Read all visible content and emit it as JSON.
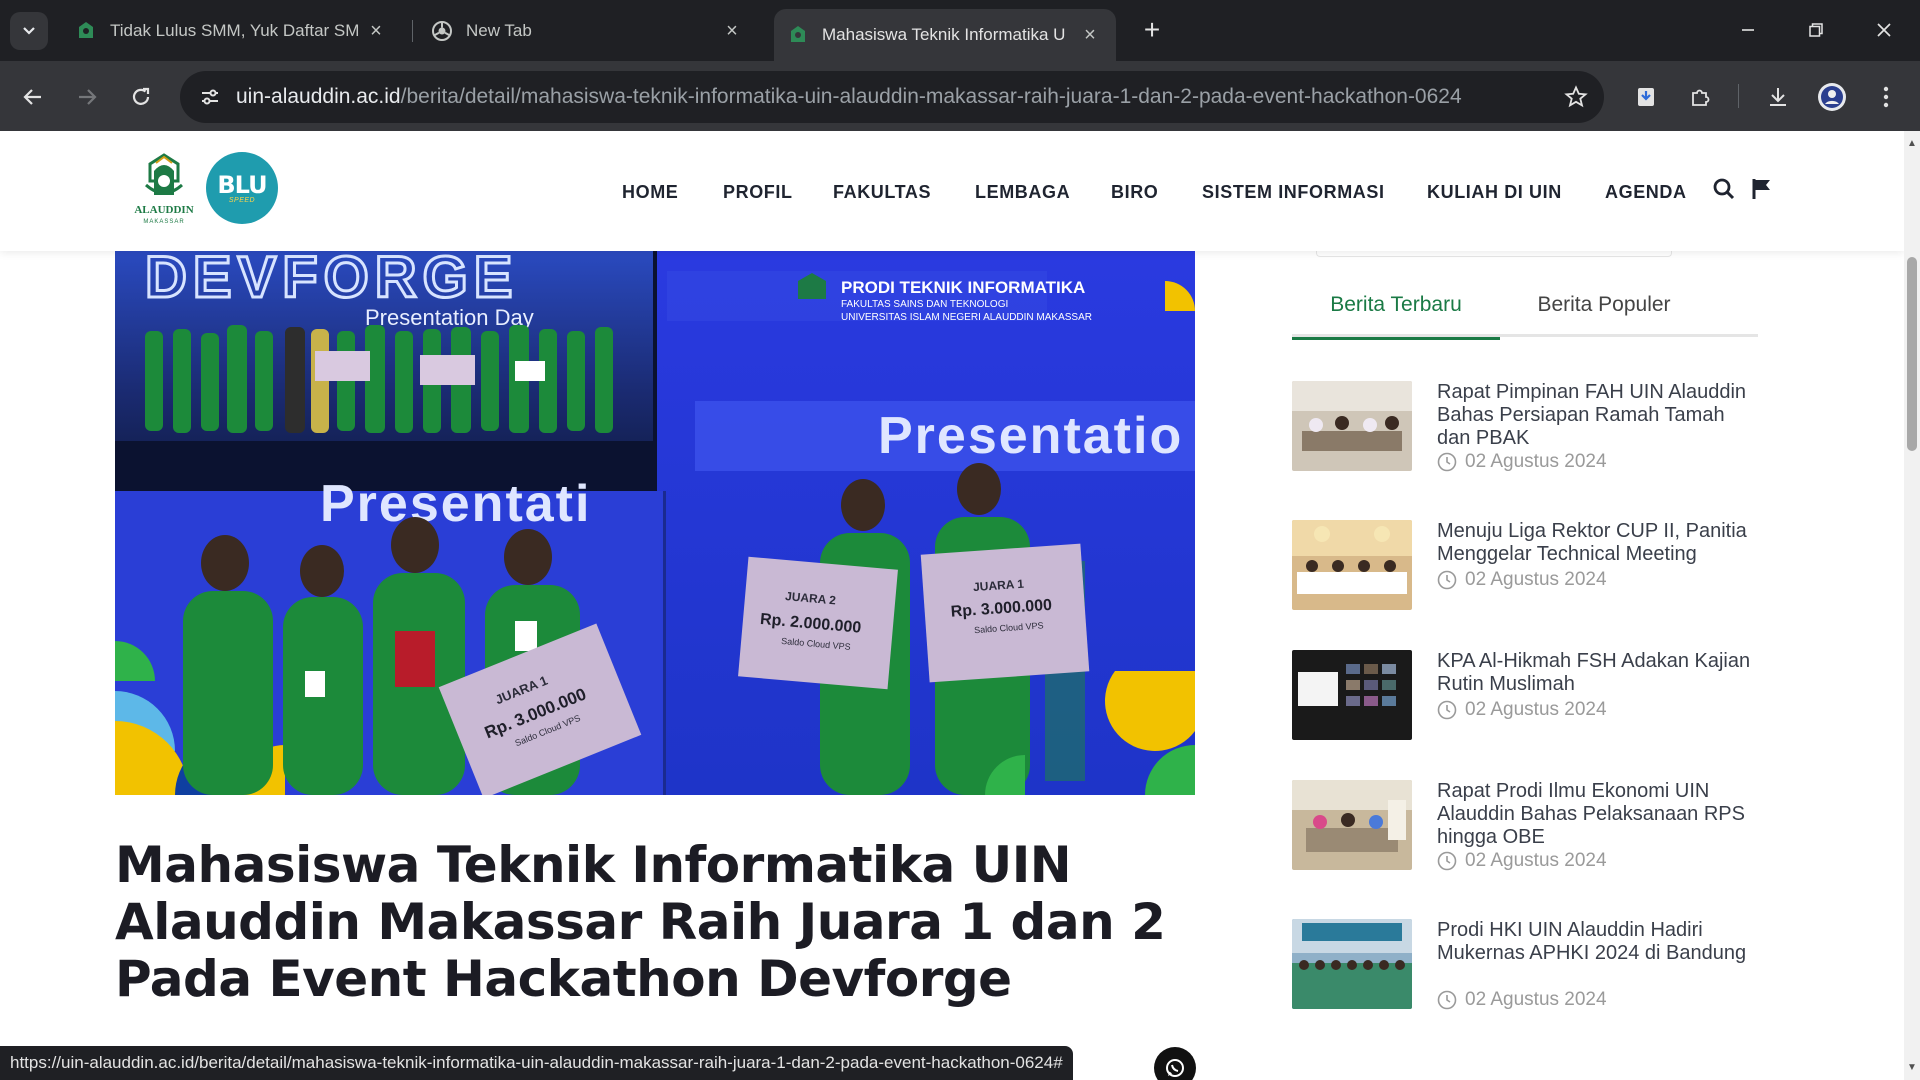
{
  "browser": {
    "tabs": [
      {
        "title": "Tidak Lulus SMM, Yuk Daftar SM",
        "active": false
      },
      {
        "title": "New Tab",
        "active": false
      },
      {
        "title": "Mahasiswa Teknik Informatika U",
        "active": true
      }
    ],
    "url_host": "uin-alauddin.ac.id",
    "url_path": "/berita/detail/mahasiswa-teknik-informatika-uin-alauddin-makassar-raih-juara-1-dan-2-pada-event-hackathon-0624",
    "status_url": "https://uin-alauddin.ac.id/berita/detail/mahasiswa-teknik-informatika-uin-alauddin-makassar-raih-juara-1-dan-2-pada-event-hackathon-0624#"
  },
  "header": {
    "logo_text": "ALAUDDIN",
    "logo_subtext": "MAKASSAR",
    "blu_text": "BLU",
    "blu_subtext": "SPEED",
    "nav": [
      "HOME",
      "PROFIL",
      "FAKULTAS",
      "LEMBAGA",
      "BIRO",
      "SISTEM INFORMASI",
      "KULIAH DI UIN",
      "AGENDA"
    ]
  },
  "hero": {
    "banner_left": "DEVFORGE",
    "presentation_day": "Presentation Day",
    "prodi_title": "PRODI TEKNIK INFORMATIKA",
    "prodi_line1": "FAKULTAS SAINS DAN TEKNOLOGI",
    "prodi_line2": "UNIVERSITAS ISLAM NEGERI ALAUDDIN MAKASSAR",
    "presentation_word": "Presentatio",
    "presentation_word_bottom": "Presentati",
    "cheques": [
      {
        "label": "JUARA 1",
        "amount": "Rp. 3.000.000",
        "note": "Saldo Cloud VPS"
      },
      {
        "label": "JUARA 2",
        "amount": "Rp. 2.000.000",
        "note": "Saldo Cloud VPS"
      },
      {
        "label": "JUARA 1",
        "amount": "Rp. 3.000.000",
        "note": "Saldo Cloud VPS"
      }
    ]
  },
  "article": {
    "title": "Mahasiswa Teknik Informatika UIN Alauddin Makassar Raih Juara 1 dan 2 Pada Event Hackathon Devforge"
  },
  "sidebar": {
    "tabs": [
      "Berita Terbaru",
      "Berita Populer"
    ],
    "news": [
      {
        "title": "Rapat Pimpinan FAH UIN Alauddin Bahas Persiapan Ramah Tamah dan PBAK",
        "date": "02 Agustus 2024"
      },
      {
        "title": "Menuju Liga Rektor CUP II, Panitia Menggelar Technical Meeting",
        "date": "02 Agustus 2024"
      },
      {
        "title": "KPA Al-Hikmah FSH Adakan Kajian Rutin Muslimah",
        "date": "02 Agustus 2024"
      },
      {
        "title": "Rapat Prodi Ilmu Ekonomi UIN Alauddin Bahas Pelaksanaan RPS hingga OBE",
        "date": "02 Agustus 2024"
      },
      {
        "title": "Prodi HKI UIN Alauddin Hadiri Mukernas APHKI 2024 di Bandung",
        "date": "02 Agustus 2024"
      }
    ]
  },
  "colors": {
    "brand_green": "#1a7a45",
    "blu_teal": "#1f9cae",
    "chrome_dark": "#1f2024",
    "chrome_toolbar": "#35363a"
  }
}
